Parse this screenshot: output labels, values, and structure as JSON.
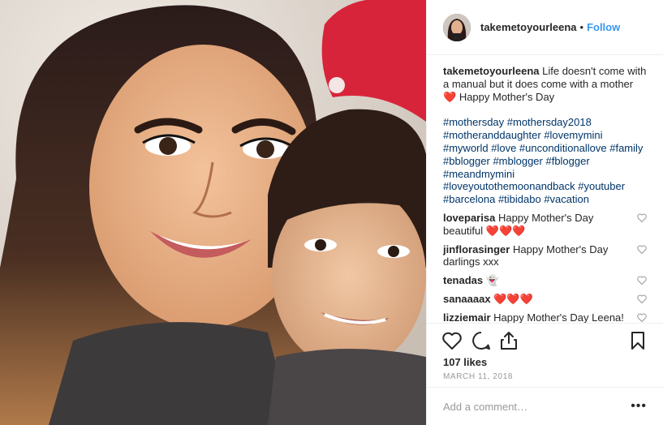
{
  "header": {
    "username": "takemetoyourleena",
    "separator": "•",
    "follow_label": "Follow"
  },
  "caption": {
    "username": "takemetoyourleena",
    "text_before": "Life doesn't come with a manual but it does come with a mother",
    "emoji": "❤️",
    "text_after": "Happy Mother's Day",
    "hashtags": "#mothersday #mothersday2018 #motheranddaughter #lovemymini #myworld #love #unconditionallove #family #bblogger #mblogger #fblogger #meandmymini #loveyoutothemoonandback #youtuber #barcelona #tibidabo #vacation"
  },
  "comments": [
    {
      "username": "loveparisa",
      "text": "Happy Mother's Day beautiful ❤️❤️❤️"
    },
    {
      "username": "jinflorasinger",
      "text": "Happy Mother's Day darlings xxx"
    },
    {
      "username": "tenadas",
      "text": "👻"
    },
    {
      "username": "sanaaaax",
      "text": "❤️❤️❤️"
    },
    {
      "username": "lizziemair",
      "text": "Happy Mother's Day Leena! You are both so gorgeous!!"
    }
  ],
  "post": {
    "likes": "107 likes",
    "date": "MARCH 11, 2018"
  },
  "add_comment": {
    "placeholder": "Add a comment…",
    "more_label": "•••"
  },
  "icons": {
    "like": "heart-icon",
    "comment": "comment-icon",
    "share": "share-icon",
    "save": "bookmark-icon",
    "comment_like": "small-heart-icon"
  },
  "colors": {
    "link": "#3897f0",
    "hashtag": "#003569",
    "muted": "#999999",
    "text": "#262626",
    "border": "#efefef"
  }
}
